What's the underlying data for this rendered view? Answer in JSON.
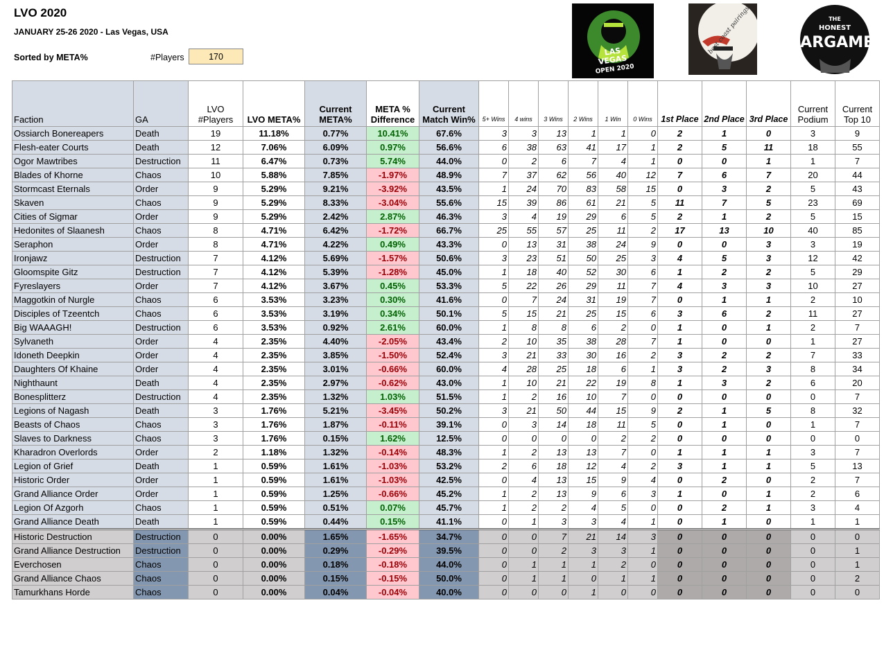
{
  "header": {
    "title": "LVO 2020",
    "subtitle": "JANUARY 25-26 2020 - Las Vegas, USA",
    "sorted_by": "Sorted by META%",
    "players_label": "#Players",
    "players_value": "170"
  },
  "logos": {
    "lvo_text1": "LAS",
    "lvo_text2": "VEGAS",
    "lvo_text3": "OPEN 2020",
    "bcp_text": "best coast pairings",
    "thw_text1": "THE",
    "thw_text2": "HONEST",
    "thw_text3": "WARGAMER"
  },
  "columns": [
    "Faction",
    "GA",
    "LVO\n#Players",
    "LVO META%",
    "Current\nMETA%",
    "META %\nDifference",
    "Current\nMatch Win%",
    "5+ Wins",
    "4 wins",
    "3 Wins",
    "2 Wins",
    "1 Win",
    "0 Wins",
    "1st Place",
    "2nd Place",
    "3rd Place",
    "Current\nPodium",
    "Current\nTop 10"
  ],
  "rows": [
    [
      "Ossiarch Bonereapers",
      "Death",
      "19",
      "11.18%",
      "0.77%",
      "10.41%",
      "67.6%",
      "3",
      "3",
      "13",
      "1",
      "1",
      "0",
      "2",
      "1",
      "0",
      "3",
      "9"
    ],
    [
      "Flesh-eater Courts",
      "Death",
      "12",
      "7.06%",
      "6.09%",
      "0.97%",
      "56.6%",
      "6",
      "38",
      "63",
      "41",
      "17",
      "1",
      "2",
      "5",
      "11",
      "18",
      "55"
    ],
    [
      "Ogor Mawtribes",
      "Destruction",
      "11",
      "6.47%",
      "0.73%",
      "5.74%",
      "44.0%",
      "0",
      "2",
      "6",
      "7",
      "4",
      "1",
      "0",
      "0",
      "1",
      "1",
      "7"
    ],
    [
      "Blades of Khorne",
      "Chaos",
      "10",
      "5.88%",
      "7.85%",
      "-1.97%",
      "48.9%",
      "7",
      "37",
      "62",
      "56",
      "40",
      "12",
      "7",
      "6",
      "7",
      "20",
      "44"
    ],
    [
      "Stormcast Eternals",
      "Order",
      "9",
      "5.29%",
      "9.21%",
      "-3.92%",
      "43.5%",
      "1",
      "24",
      "70",
      "83",
      "58",
      "15",
      "0",
      "3",
      "2",
      "5",
      "43"
    ],
    [
      "Skaven",
      "Chaos",
      "9",
      "5.29%",
      "8.33%",
      "-3.04%",
      "55.6%",
      "15",
      "39",
      "86",
      "61",
      "21",
      "5",
      "11",
      "7",
      "5",
      "23",
      "69"
    ],
    [
      "Cities of Sigmar",
      "Order",
      "9",
      "5.29%",
      "2.42%",
      "2.87%",
      "46.3%",
      "3",
      "4",
      "19",
      "29",
      "6",
      "5",
      "2",
      "1",
      "2",
      "5",
      "15"
    ],
    [
      "Hedonites of Slaanesh",
      "Chaos",
      "8",
      "4.71%",
      "6.42%",
      "-1.72%",
      "66.7%",
      "25",
      "55",
      "57",
      "25",
      "11",
      "2",
      "17",
      "13",
      "10",
      "40",
      "85"
    ],
    [
      "Seraphon",
      "Order",
      "8",
      "4.71%",
      "4.22%",
      "0.49%",
      "43.3%",
      "0",
      "13",
      "31",
      "38",
      "24",
      "9",
      "0",
      "0",
      "3",
      "3",
      "19"
    ],
    [
      "Ironjawz",
      "Destruction",
      "7",
      "4.12%",
      "5.69%",
      "-1.57%",
      "50.6%",
      "3",
      "23",
      "51",
      "50",
      "25",
      "3",
      "4",
      "5",
      "3",
      "12",
      "42"
    ],
    [
      "Gloomspite Gitz",
      "Destruction",
      "7",
      "4.12%",
      "5.39%",
      "-1.28%",
      "45.0%",
      "1",
      "18",
      "40",
      "52",
      "30",
      "6",
      "1",
      "2",
      "2",
      "5",
      "29"
    ],
    [
      "Fyreslayers",
      "Order",
      "7",
      "4.12%",
      "3.67%",
      "0.45%",
      "53.3%",
      "5",
      "22",
      "26",
      "29",
      "11",
      "7",
      "4",
      "3",
      "3",
      "10",
      "27"
    ],
    [
      "Maggotkin of Nurgle",
      "Chaos",
      "6",
      "3.53%",
      "3.23%",
      "0.30%",
      "41.6%",
      "0",
      "7",
      "24",
      "31",
      "19",
      "7",
      "0",
      "1",
      "1",
      "2",
      "10"
    ],
    [
      "Disciples of Tzeentch",
      "Chaos",
      "6",
      "3.53%",
      "3.19%",
      "0.34%",
      "50.1%",
      "5",
      "15",
      "21",
      "25",
      "15",
      "6",
      "3",
      "6",
      "2",
      "11",
      "27"
    ],
    [
      "Big WAAAGH!",
      "Destruction",
      "6",
      "3.53%",
      "0.92%",
      "2.61%",
      "60.0%",
      "1",
      "8",
      "8",
      "6",
      "2",
      "0",
      "1",
      "0",
      "1",
      "2",
      "7"
    ],
    [
      "Sylvaneth",
      "Order",
      "4",
      "2.35%",
      "4.40%",
      "-2.05%",
      "43.4%",
      "2",
      "10",
      "35",
      "38",
      "28",
      "7",
      "1",
      "0",
      "0",
      "1",
      "27"
    ],
    [
      "Idoneth Deepkin",
      "Order",
      "4",
      "2.35%",
      "3.85%",
      "-1.50%",
      "52.4%",
      "3",
      "21",
      "33",
      "30",
      "16",
      "2",
      "3",
      "2",
      "2",
      "7",
      "33"
    ],
    [
      "Daughters Of Khaine",
      "Order",
      "4",
      "2.35%",
      "3.01%",
      "-0.66%",
      "60.0%",
      "4",
      "28",
      "25",
      "18",
      "6",
      "1",
      "3",
      "2",
      "3",
      "8",
      "34"
    ],
    [
      "Nighthaunt",
      "Death",
      "4",
      "2.35%",
      "2.97%",
      "-0.62%",
      "43.0%",
      "1",
      "10",
      "21",
      "22",
      "19",
      "8",
      "1",
      "3",
      "2",
      "6",
      "20"
    ],
    [
      "Bonesplitterz",
      "Destruction",
      "4",
      "2.35%",
      "1.32%",
      "1.03%",
      "51.5%",
      "1",
      "2",
      "16",
      "10",
      "7",
      "0",
      "0",
      "0",
      "0",
      "0",
      "7"
    ],
    [
      "Legions of Nagash",
      "Death",
      "3",
      "1.76%",
      "5.21%",
      "-3.45%",
      "50.2%",
      "3",
      "21",
      "50",
      "44",
      "15",
      "9",
      "2",
      "1",
      "5",
      "8",
      "32"
    ],
    [
      "Beasts of Chaos",
      "Chaos",
      "3",
      "1.76%",
      "1.87%",
      "-0.11%",
      "39.1%",
      "0",
      "3",
      "14",
      "18",
      "11",
      "5",
      "0",
      "1",
      "0",
      "1",
      "7"
    ],
    [
      "Slaves to Darkness",
      "Chaos",
      "3",
      "1.76%",
      "0.15%",
      "1.62%",
      "12.5%",
      "0",
      "0",
      "0",
      "0",
      "2",
      "2",
      "0",
      "0",
      "0",
      "0",
      "0"
    ],
    [
      "Kharadron Overlords",
      "Order",
      "2",
      "1.18%",
      "1.32%",
      "-0.14%",
      "48.3%",
      "1",
      "2",
      "13",
      "13",
      "7",
      "0",
      "1",
      "1",
      "1",
      "3",
      "7"
    ],
    [
      "Legion of Grief",
      "Death",
      "1",
      "0.59%",
      "1.61%",
      "-1.03%",
      "53.2%",
      "2",
      "6",
      "18",
      "12",
      "4",
      "2",
      "3",
      "1",
      "1",
      "5",
      "13"
    ],
    [
      "Historic Order",
      "Order",
      "1",
      "0.59%",
      "1.61%",
      "-1.03%",
      "42.5%",
      "0",
      "4",
      "13",
      "15",
      "9",
      "4",
      "0",
      "2",
      "0",
      "2",
      "7"
    ],
    [
      "Grand Alliance Order",
      "Order",
      "1",
      "0.59%",
      "1.25%",
      "-0.66%",
      "45.2%",
      "1",
      "2",
      "13",
      "9",
      "6",
      "3",
      "1",
      "0",
      "1",
      "2",
      "6"
    ],
    [
      "Legion Of Azgorh",
      "Chaos",
      "1",
      "0.59%",
      "0.51%",
      "0.07%",
      "45.7%",
      "1",
      "2",
      "2",
      "4",
      "5",
      "0",
      "0",
      "2",
      "1",
      "3",
      "4"
    ],
    [
      "Grand Alliance Death",
      "Death",
      "1",
      "0.59%",
      "0.44%",
      "0.15%",
      "41.1%",
      "0",
      "1",
      "3",
      "3",
      "4",
      "1",
      "0",
      "1",
      "0",
      "1",
      "1"
    ]
  ],
  "zero_rows": [
    [
      "Historic Destruction",
      "Destruction",
      "0",
      "0.00%",
      "1.65%",
      "-1.65%",
      "34.7%",
      "0",
      "0",
      "7",
      "21",
      "14",
      "3",
      "0",
      "0",
      "0",
      "0",
      "0"
    ],
    [
      "Grand Alliance Destruction",
      "Destruction",
      "0",
      "0.00%",
      "0.29%",
      "-0.29%",
      "39.5%",
      "0",
      "0",
      "2",
      "3",
      "3",
      "1",
      "0",
      "0",
      "0",
      "0",
      "1"
    ],
    [
      "Everchosen",
      "Chaos",
      "0",
      "0.00%",
      "0.18%",
      "-0.18%",
      "44.0%",
      "0",
      "1",
      "1",
      "1",
      "2",
      "0",
      "0",
      "0",
      "0",
      "0",
      "1"
    ],
    [
      "Grand Alliance Chaos",
      "Chaos",
      "0",
      "0.00%",
      "0.15%",
      "-0.15%",
      "50.0%",
      "0",
      "1",
      "1",
      "0",
      "1",
      "1",
      "0",
      "0",
      "0",
      "0",
      "2"
    ],
    [
      "Tamurkhans Horde",
      "Chaos",
      "0",
      "0.00%",
      "0.04%",
      "-0.04%",
      "40.0%",
      "0",
      "0",
      "0",
      "1",
      "0",
      "0",
      "0",
      "0",
      "0",
      "0",
      "0"
    ]
  ]
}
